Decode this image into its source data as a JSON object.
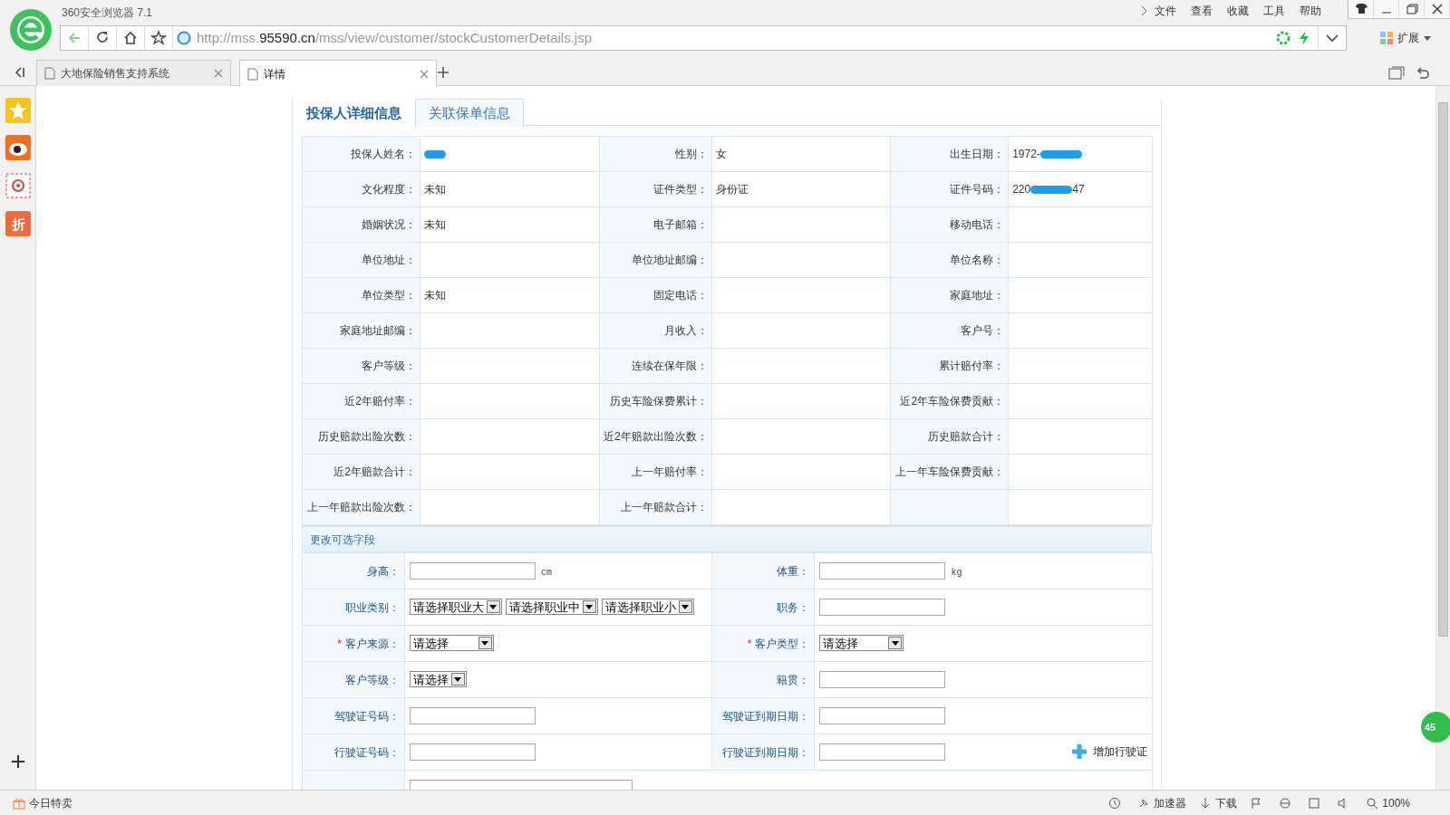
{
  "browser": {
    "title": "360安全浏览器 7.1",
    "menu": [
      "文件",
      "查看",
      "收藏",
      "工具",
      "帮助"
    ],
    "url": {
      "scheme": "http://mss.",
      "domain": "95590.cn",
      "path": "/mss/view/customer/stockCustomerDetails.jsp"
    },
    "extensions_label": "扩展",
    "tabs": [
      {
        "label": "大地保险销售支持系统",
        "selected": false
      },
      {
        "label": "详情",
        "selected": true
      }
    ],
    "sidebar_badge": "折",
    "floating_badge": "45",
    "status_bar": {
      "promo": "今日特卖",
      "accelerator": "加速器",
      "download": "下载",
      "zoom": "100%"
    }
  },
  "page": {
    "tabs": [
      {
        "label": "投保人详细信息",
        "selected": true
      },
      {
        "label": "关联保单信息",
        "selected": false
      }
    ],
    "details": [
      [
        {
          "label": "投保人姓名：",
          "redacted": true
        },
        {
          "label": "性别：",
          "value": "女"
        },
        {
          "label": "出生日期：",
          "value": "1972-",
          "redacted": true
        }
      ],
      [
        {
          "label": "文化程度：",
          "value": "未知"
        },
        {
          "label": "证件类型：",
          "value": "身份证"
        },
        {
          "label": "证件号码：",
          "value": "220",
          "value_end": "47",
          "redacted": true
        }
      ],
      [
        {
          "label": "婚姻状况：",
          "value": "未知"
        },
        {
          "label": "电子邮箱："
        },
        {
          "label": "移动电话："
        }
      ],
      [
        {
          "label": "单位地址："
        },
        {
          "label": "单位地址邮编："
        },
        {
          "label": "单位名称："
        }
      ],
      [
        {
          "label": "单位类型：",
          "value": "未知"
        },
        {
          "label": "固定电话："
        },
        {
          "label": "家庭地址："
        }
      ],
      [
        {
          "label": "家庭地址邮编："
        },
        {
          "label": "月收入："
        },
        {
          "label": "客户号："
        }
      ],
      [
        {
          "label": "客户等级："
        },
        {
          "label": "连续在保年限："
        },
        {
          "label": "累计赔付率："
        }
      ],
      [
        {
          "label": "近2年赔付率："
        },
        {
          "label": "历史车险保费累计："
        },
        {
          "label": "近2年车险保费贡献："
        }
      ],
      [
        {
          "label": "历史赔款出险次数："
        },
        {
          "label": "近2年赔款出险次数："
        },
        {
          "label": "历史赔款合计："
        }
      ],
      [
        {
          "label": "近2年赔款合计："
        },
        {
          "label": "上一年赔付率："
        },
        {
          "label": "上一年车险保费贡献："
        }
      ],
      [
        {
          "label": "上一年赔款出险次数："
        },
        {
          "label": "上一年赔款合计："
        }
      ]
    ],
    "section_title": "更改可选字段",
    "form": [
      [
        {
          "label": "身高：",
          "controls": [
            {
              "kind": "input",
              "unit": "cm"
            }
          ]
        },
        {
          "label": "体重：",
          "controls": [
            {
              "kind": "input",
              "unit": "kg"
            }
          ]
        }
      ],
      [
        {
          "label": "职业类别：",
          "controls": [
            {
              "kind": "select",
              "value": "请选择职业大"
            },
            {
              "kind": "select",
              "value": "请选择职业中"
            },
            {
              "kind": "select",
              "value": "请选择职业小"
            }
          ]
        },
        {
          "label": "职务：",
          "controls": [
            {
              "kind": "input"
            }
          ]
        }
      ],
      [
        {
          "label": "客户来源：",
          "required_mark": "*",
          "controls": [
            {
              "kind": "select",
              "value": "请选择",
              "wide": true
            }
          ]
        },
        {
          "label": "客户类型：",
          "required_mark": "*",
          "controls": [
            {
              "kind": "select",
              "value": "请选择",
              "wide": true
            }
          ]
        }
      ],
      [
        {
          "label": "客户等级：",
          "controls": [
            {
              "kind": "select",
              "value": "请选择"
            }
          ]
        },
        {
          "label": "籍贯：",
          "controls": [
            {
              "kind": "input"
            }
          ]
        }
      ],
      [
        {
          "label": "驾驶证号码：",
          "controls": [
            {
              "kind": "input"
            }
          ]
        },
        {
          "label": "驾驶证到期日期：",
          "controls": [
            {
              "kind": "input"
            }
          ]
        }
      ],
      [
        {
          "label": "行驶证号码：",
          "controls": [
            {
              "kind": "input"
            }
          ]
        },
        {
          "label": "行驶证到期日期：",
          "controls": [
            {
              "kind": "input"
            },
            {
              "kind": "add",
              "value": "增加行驶证"
            }
          ]
        }
      ],
      [
        {
          "controls": [
            {
              "kind": "longinput"
            }
          ]
        }
      ]
    ]
  }
}
